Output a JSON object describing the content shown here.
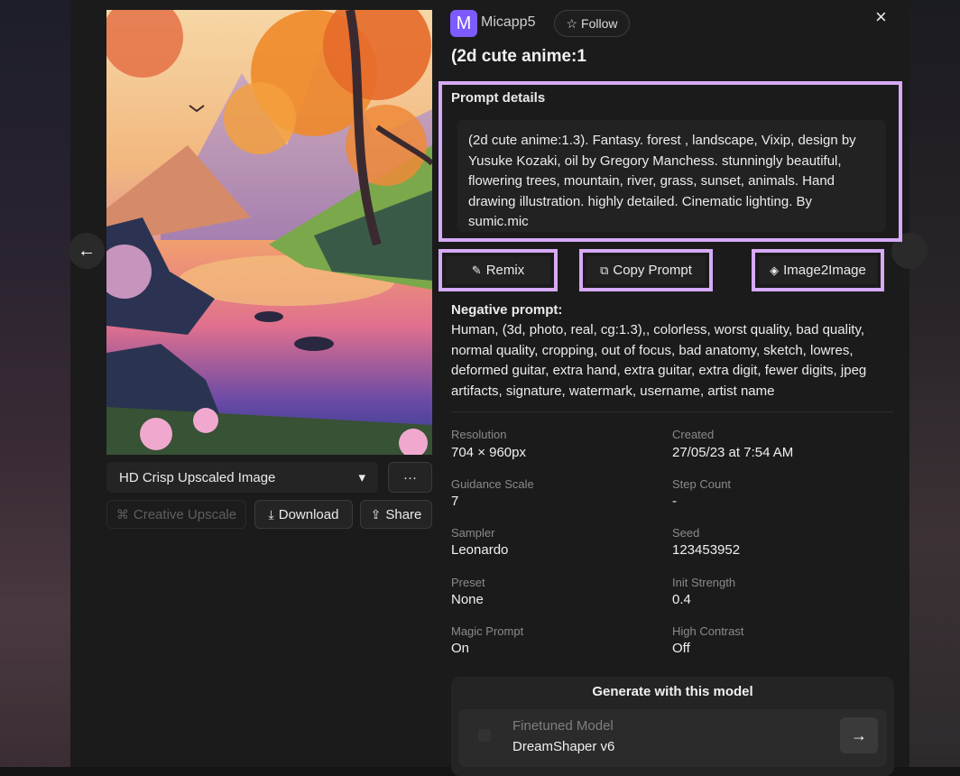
{
  "user": {
    "avatar_letter": "M",
    "name": "Micapp5",
    "follow_label": "Follow"
  },
  "title": "(2d cute anime:1",
  "prompt": {
    "label": "Prompt details",
    "text": "(2d cute anime:1.3). Fantasy. forest , landscape, Vixip, design by Yusuke Kozaki, oil by Gregory Manchess. stunningly beautiful, flowering trees, mountain, river, grass, sunset, animals. Hand drawing illustration. highly detailed. Cinematic lighting. By sumic.mic"
  },
  "actions": {
    "remix": "Remix",
    "copy": "Copy Prompt",
    "image2image": "Image2Image"
  },
  "negative": {
    "label": "Negative prompt:",
    "text": "Human, (3d, photo, real, cg:1.3),, colorless, worst quality, bad quality, normal quality, cropping, out of focus, bad anatomy, sketch, lowres, deformed guitar, extra hand, extra guitar, extra digit, fewer digits, jpeg artifacts, signature, watermark, username, artist name"
  },
  "meta": {
    "resolution_label": "Resolution",
    "resolution": "704 × 960px",
    "created_label": "Created",
    "created": "27/05/23 at 7:54 AM",
    "guidance_label": "Guidance Scale",
    "guidance": "7",
    "steps_label": "Step Count",
    "steps": "-",
    "sampler_label": "Sampler",
    "sampler": "Leonardo",
    "seed_label": "Seed",
    "seed": "123453952",
    "preset_label": "Preset",
    "preset": "None",
    "init_label": "Init Strength",
    "init": "0.4",
    "magic_label": "Magic Prompt",
    "magic": "On",
    "contrast_label": "High Contrast",
    "contrast": "Off"
  },
  "image_controls": {
    "upscale_select": "HD Crisp Upscaled Image",
    "more": "···",
    "creative": "Creative Upscale",
    "download": "Download",
    "share": "Share"
  },
  "generate": {
    "title": "Generate with this model",
    "model_label": "Finetuned Model",
    "model_name": "DreamShaper v6"
  },
  "icons": {
    "close": "×",
    "arrow_left": "←",
    "arrow_right": "→",
    "star": "☆",
    "chevron": "▾",
    "remix": "✎",
    "copy": "⧉",
    "image2image": "◈",
    "download": "⤓",
    "share": "⇪",
    "creative": "⌘"
  }
}
